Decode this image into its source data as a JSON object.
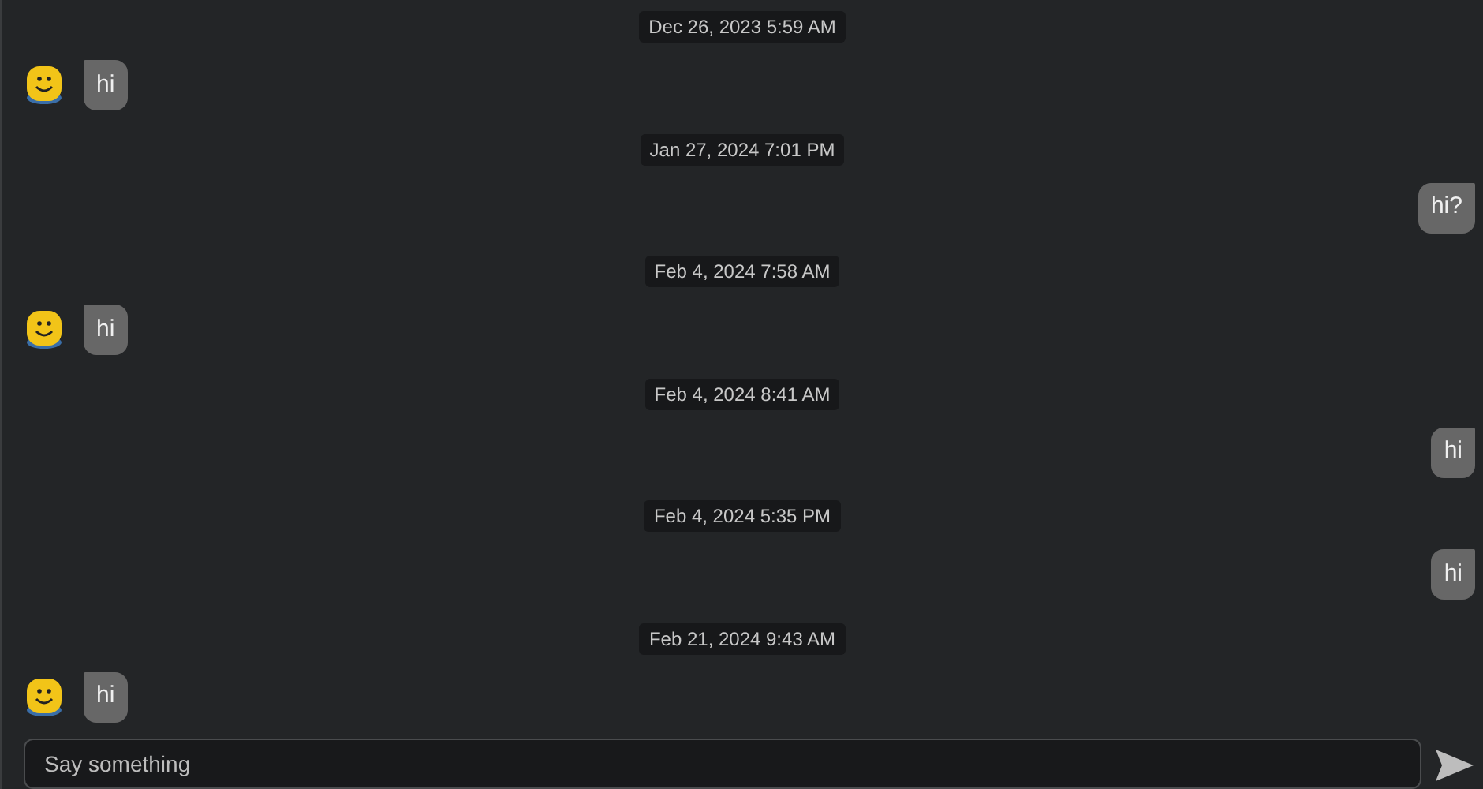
{
  "messages": [
    {
      "time": "Dec 26, 2023 5:59 AM",
      "kind": "incoming",
      "text": "hi"
    },
    {
      "time": "Jan 27, 2024 7:01 PM",
      "kind": "outgoing",
      "text": "hi?"
    },
    {
      "time": "Feb 4, 2024 7:58 AM",
      "kind": "incoming",
      "text": "hi"
    },
    {
      "time": "Feb 4, 2024 8:41 AM",
      "kind": "outgoing",
      "text": "hi"
    },
    {
      "time": "Feb 4, 2024 5:35 PM",
      "kind": "outgoing",
      "text": "hi"
    },
    {
      "time": "Feb 21, 2024 9:43 AM",
      "kind": "incoming",
      "text": "hi"
    }
  ],
  "composer": {
    "placeholder": "Say something"
  }
}
